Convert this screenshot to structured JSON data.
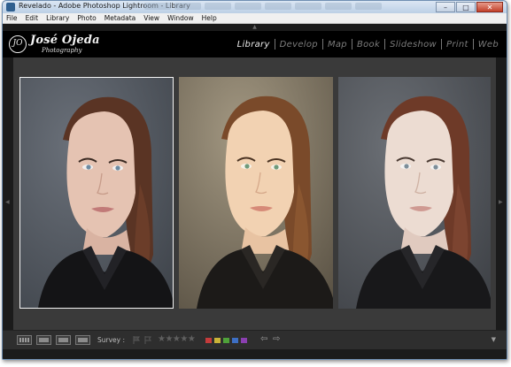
{
  "window": {
    "title": "Revelado - Adobe Photoshop Lightroom - Library",
    "controls": {
      "minimize": "–",
      "maximize": "□",
      "close": "✕"
    }
  },
  "menu": [
    "File",
    "Edit",
    "Library",
    "Photo",
    "Metadata",
    "View",
    "Window",
    "Help"
  ],
  "identity_plate": {
    "mark": "JO",
    "name": "José Ojeda",
    "subtitle": "Photography"
  },
  "modules": [
    {
      "label": "Library",
      "active": true
    },
    {
      "label": "Develop",
      "active": false
    },
    {
      "label": "Map",
      "active": false
    },
    {
      "label": "Book",
      "active": false
    },
    {
      "label": "Slideshow",
      "active": false
    },
    {
      "label": "Print",
      "active": false
    },
    {
      "label": "Web",
      "active": false
    }
  ],
  "toolbar": {
    "view_mode_label": "Survey :",
    "stars": "★★★★★",
    "color_labels": [
      "#c43b3b",
      "#c9b338",
      "#4fa13a",
      "#3d6fc4",
      "#8a3fb0"
    ],
    "prev_arrow": "⇦",
    "next_arrow": "⇨",
    "menu_arrow": "▼"
  },
  "panel_toggles": {
    "top": "▲",
    "left": "◀",
    "right": "▶"
  },
  "photos": [
    {
      "variant": "original",
      "selected": true
    },
    {
      "variant": "warm",
      "selected": false
    },
    {
      "variant": "desaturated",
      "selected": false
    }
  ]
}
